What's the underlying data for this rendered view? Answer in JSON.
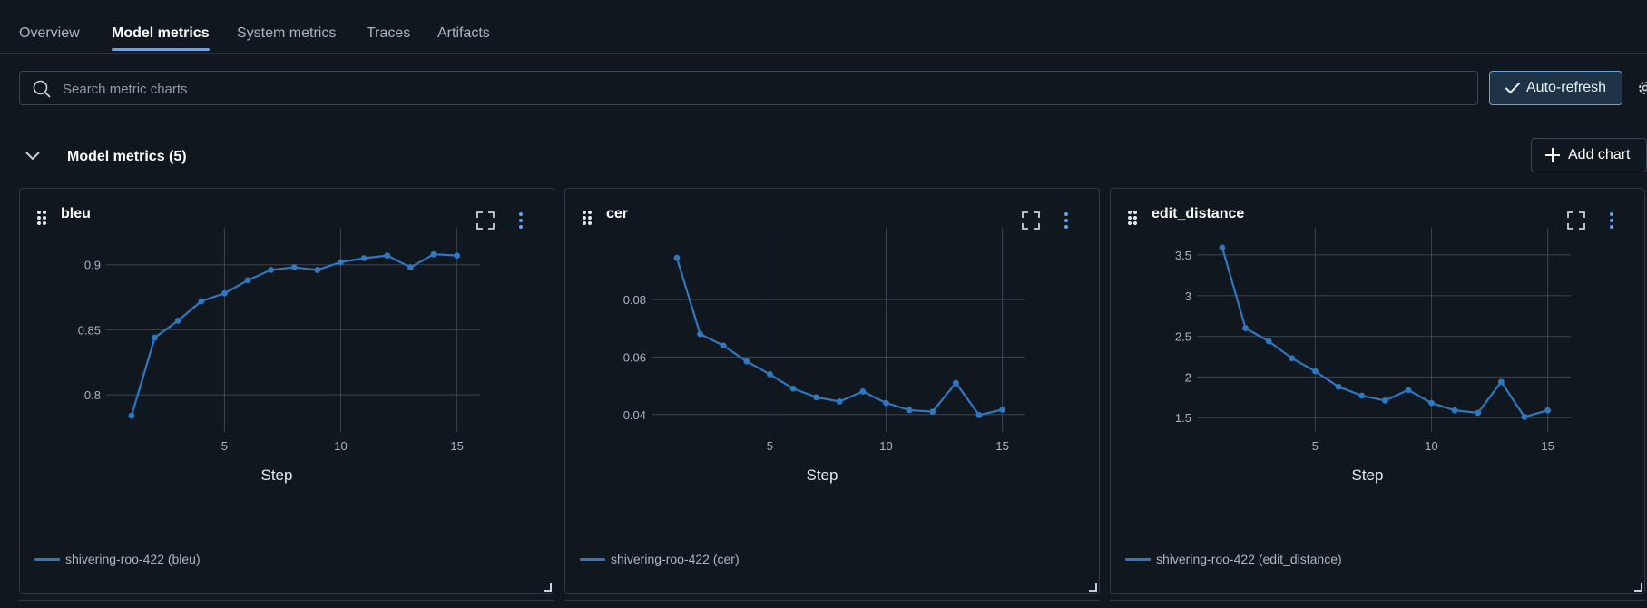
{
  "tabs": [
    {
      "label": "Overview",
      "active": false
    },
    {
      "label": "Model metrics",
      "active": true
    },
    {
      "label": "System metrics",
      "active": false
    },
    {
      "label": "Traces",
      "active": false
    },
    {
      "label": "Artifacts",
      "active": false
    }
  ],
  "search": {
    "placeholder": "Search metric charts",
    "value": ""
  },
  "toolbar": {
    "auto_refresh_label": "Auto-refresh",
    "auto_refresh_checked": true
  },
  "section": {
    "title": "Model metrics (5)",
    "add_chart_label": "Add chart"
  },
  "colors": {
    "accent": "#5aa3ff",
    "series": "#2e78c0",
    "grid": "#3a4452"
  },
  "icons": {
    "search": "search-icon",
    "check": "check-icon",
    "gear": "gear-icon",
    "chevron": "chevron-down-icon",
    "plus": "plus-icon",
    "drag": "drag-handle-icon",
    "expand": "fullscreen-icon",
    "kebab": "kebab-menu-icon",
    "resize": "resize-handle-icon"
  },
  "chart_data": [
    {
      "type": "line",
      "title": "bleu",
      "xlabel": "Step",
      "ylabel": "",
      "xlim": [
        0.3,
        15.6
      ],
      "ylim": [
        0.775,
        0.92
      ],
      "xticks": [
        5,
        10,
        15
      ],
      "yticks": [
        0.8,
        0.85,
        0.9
      ],
      "ytick_labels": [
        "0.8",
        "0.85",
        "0.9"
      ],
      "x": [
        1,
        2,
        3,
        4,
        5,
        6,
        7,
        8,
        9,
        10,
        11,
        12,
        13,
        14,
        15
      ],
      "series": [
        {
          "name": "shivering-roo-422 (bleu)",
          "values": [
            0.784,
            0.844,
            0.857,
            0.872,
            0.878,
            0.888,
            0.896,
            0.898,
            0.896,
            0.902,
            0.905,
            0.907,
            0.898,
            0.908,
            0.907
          ]
        }
      ]
    },
    {
      "type": "line",
      "title": "cer",
      "xlabel": "Step",
      "ylabel": "",
      "xlim": [
        0.3,
        15.6
      ],
      "ylim": [
        0.0355,
        0.1012
      ],
      "xticks": [
        5,
        10,
        15
      ],
      "yticks": [
        0.04,
        0.06,
        0.08
      ],
      "ytick_labels": [
        "0.04",
        "0.06",
        "0.08"
      ],
      "x": [
        1,
        2,
        3,
        4,
        5,
        6,
        7,
        8,
        9,
        10,
        11,
        12,
        13,
        14,
        15
      ],
      "series": [
        {
          "name": "shivering-roo-422 (cer)",
          "values": [
            0.0945,
            0.068,
            0.064,
            0.0585,
            0.054,
            0.049,
            0.046,
            0.0445,
            0.048,
            0.044,
            0.0415,
            0.041,
            0.051,
            0.0398,
            0.0417
          ]
        }
      ]
    },
    {
      "type": "line",
      "title": "edit_distance",
      "xlabel": "Step",
      "ylabel": "",
      "xlim": [
        0.3,
        15.6
      ],
      "ylim": [
        1.38,
        3.7
      ],
      "xticks": [
        5,
        10,
        15
      ],
      "yticks": [
        1.5,
        2,
        2.5,
        3,
        3.5
      ],
      "ytick_labels": [
        "1.5",
        "2",
        "2.5",
        "3",
        "3.5"
      ],
      "x": [
        1,
        2,
        3,
        4,
        5,
        6,
        7,
        8,
        9,
        10,
        11,
        12,
        13,
        14,
        15
      ],
      "series": [
        {
          "name": "shivering-roo-422 (edit_distance)",
          "values": [
            3.59,
            2.6,
            2.44,
            2.23,
            2.07,
            1.88,
            1.77,
            1.71,
            1.84,
            1.68,
            1.59,
            1.56,
            1.94,
            1.51,
            1.59
          ]
        }
      ]
    }
  ]
}
